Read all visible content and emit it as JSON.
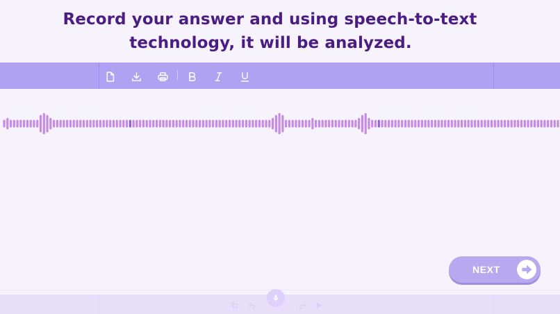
{
  "heading": {
    "line1": "Record your answer and using speech-to-text",
    "line2": "technology, it will be analyzed."
  },
  "toolbar": {
    "icons": [
      "file-icon",
      "download-icon",
      "print-icon",
      "bold-icon",
      "italic-icon",
      "underline-icon"
    ]
  },
  "waveform": {
    "bars": [
      2,
      3,
      2,
      2,
      2,
      2,
      2,
      2,
      2,
      2,
      2,
      4,
      5,
      4,
      3,
      2,
      2,
      2,
      2,
      2,
      2,
      2,
      2,
      2,
      2,
      2,
      2,
      2,
      2,
      2,
      2,
      2,
      2,
      2,
      2,
      2,
      2,
      2,
      2,
      2,
      2,
      2,
      2,
      2,
      2,
      2,
      2,
      2,
      2,
      2,
      2,
      2,
      2,
      2,
      2,
      2,
      2,
      2,
      2,
      2,
      2,
      2,
      2,
      2,
      2,
      2,
      2,
      2,
      2,
      2,
      2,
      2,
      2,
      2,
      2,
      2,
      2,
      2,
      2,
      2,
      2,
      3,
      4,
      5,
      4,
      2,
      2,
      2,
      2,
      2,
      2,
      2,
      2,
      3,
      2,
      2,
      2,
      2,
      2,
      2,
      2,
      2,
      2,
      2,
      2,
      2,
      2,
      3,
      4,
      5,
      3,
      2,
      2,
      2,
      2,
      2,
      2,
      2,
      2,
      2,
      2,
      2,
      2,
      2,
      2,
      2,
      2,
      2,
      2,
      2,
      2,
      2,
      2,
      2,
      2,
      2,
      2,
      2,
      2,
      2,
      2,
      2,
      2,
      2,
      2,
      2,
      2,
      2,
      2,
      2,
      2,
      2,
      2,
      2,
      2,
      2,
      2,
      2,
      2,
      2,
      2,
      2,
      2,
      2,
      2,
      2,
      2,
      2
    ],
    "highlight_indices": [
      38,
      113
    ]
  },
  "next_button": {
    "label": "NEXT"
  },
  "colors": {
    "title": "#4b1d82",
    "toolbar_bg": "#b0a2f2",
    "toolbar_icon": "#ffffff",
    "wave": "#c68be3",
    "wave_highlight": "#8e64d4",
    "button_bg": "#b7a9ef",
    "button_arrow": "#b7a9ef"
  }
}
